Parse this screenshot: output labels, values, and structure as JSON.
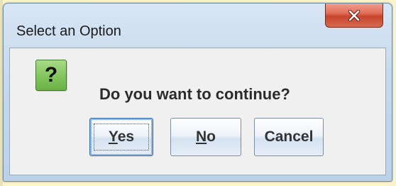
{
  "window": {
    "title": "Select an Option"
  },
  "dialog": {
    "icon": "question-icon",
    "icon_glyph": "?",
    "message": "Do you want to continue?"
  },
  "buttons": {
    "yes_mnemonic": "Y",
    "yes_rest": "es",
    "no_mnemonic": "N",
    "no_rest": "o",
    "cancel_label": "Cancel",
    "default": "yes"
  },
  "colors": {
    "background": "#fbf4c9",
    "titlebar": "#c5d8ec",
    "close_button": "#c8452c",
    "icon_green": "#7fc35a"
  }
}
